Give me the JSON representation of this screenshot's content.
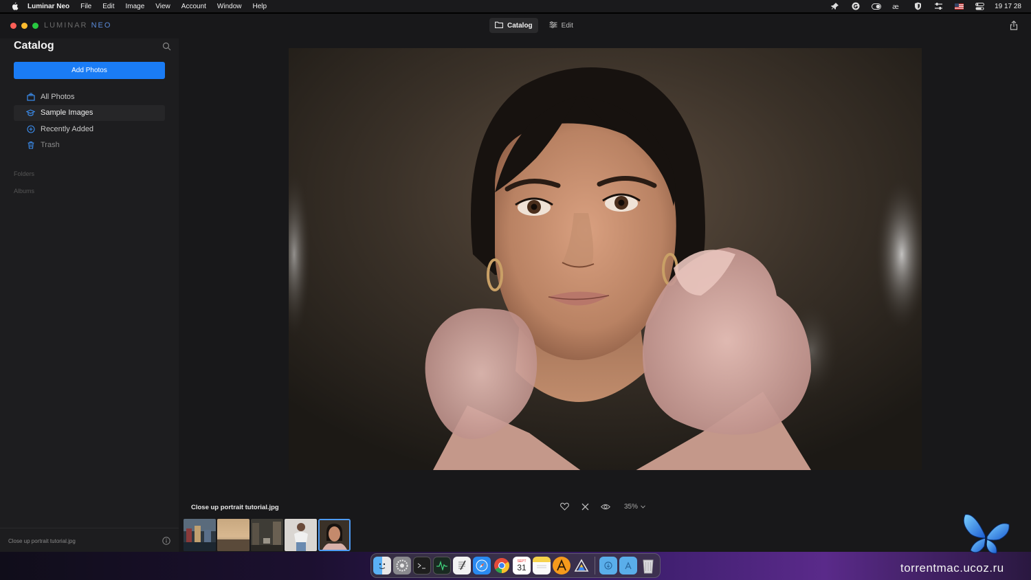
{
  "menubar": {
    "app_name": "Luminar Neo",
    "items": [
      "File",
      "Edit",
      "Image",
      "View",
      "Account",
      "Window",
      "Help"
    ],
    "clock": "19 17 28",
    "status_icons": [
      "pin-icon",
      "grammarly-icon",
      "battery-toggle-icon",
      "ae-icon",
      "shield-icon",
      "sliders-icon",
      "us-flag-icon",
      "control-center-icon"
    ]
  },
  "window": {
    "logo_left": "LUMINAR",
    "logo_right": "NEO",
    "modes": [
      {
        "label": "Catalog",
        "icon": "folder-icon",
        "active": true
      },
      {
        "label": "Edit",
        "icon": "sliders-icon",
        "active": false
      }
    ]
  },
  "sidebar": {
    "title": "Catalog",
    "add_button": "Add Photos",
    "nav": [
      {
        "label": "All Photos",
        "icon": "stack-icon",
        "selected": false
      },
      {
        "label": "Sample Images",
        "icon": "graduation-cap-icon",
        "selected": true
      },
      {
        "label": "Recently Added",
        "icon": "plus-circle-icon",
        "selected": false
      },
      {
        "label": "Trash",
        "icon": "trash-icon",
        "selected": false
      }
    ],
    "sections": [
      "Folders",
      "Albums"
    ],
    "footer_filename": "Close up portrait tutorial.jpg"
  },
  "viewer": {
    "image_name": "Close up portrait tutorial.jpg",
    "zoom": "35%",
    "thumbnails": [
      {
        "name": "thumb-harbor",
        "selected": false
      },
      {
        "name": "thumb-sunset-beach",
        "selected": false
      },
      {
        "name": "thumb-street",
        "selected": false
      },
      {
        "name": "thumb-woman-white",
        "selected": false
      },
      {
        "name": "thumb-portrait",
        "selected": true
      }
    ]
  },
  "dock": {
    "apps": [
      "finder-icon",
      "system-preferences-icon",
      "terminal-icon",
      "activity-monitor-icon",
      "textedit-icon",
      "safari-icon",
      "chrome-icon",
      "calendar-icon",
      "notes-icon",
      "app-a-icon",
      "luminar-icon"
    ],
    "calendar_month": "SEPT",
    "calendar_day": "31",
    "folders": [
      "downloads-folder-icon",
      "applications-folder-icon",
      "trash-icon"
    ]
  },
  "watermark": "torrentmac.ucoz.ru",
  "colors": {
    "accent": "#1a7cf5",
    "sidebar_bg": "#1d1d1f",
    "window_bg": "#18181a"
  }
}
